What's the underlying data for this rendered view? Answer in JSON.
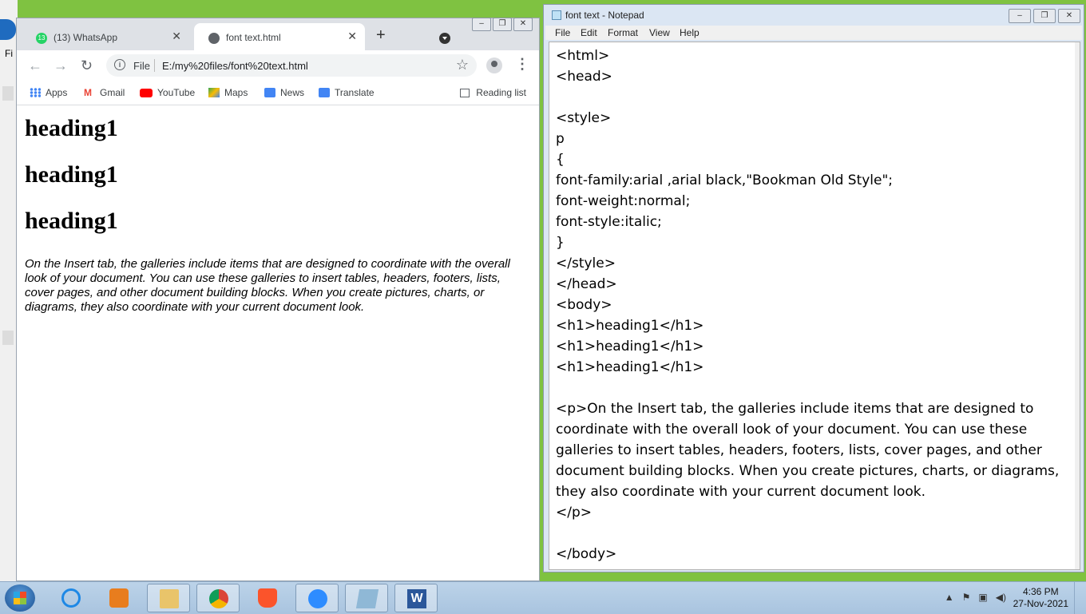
{
  "chrome": {
    "tabs": [
      {
        "title": "(13) WhatsApp",
        "badge": "13",
        "active": false
      },
      {
        "title": "font text.html",
        "active": true
      }
    ],
    "new_tab": "+",
    "address": {
      "scheme": "File",
      "url": "E:/my%20files/font%20text.html"
    },
    "bookmarks": [
      {
        "label": "Apps",
        "icon": "apps-grid-icon"
      },
      {
        "label": "Gmail",
        "icon": "gmail-icon"
      },
      {
        "label": "YouTube",
        "icon": "youtube-icon"
      },
      {
        "label": "Maps",
        "icon": "maps-icon"
      },
      {
        "label": "News",
        "icon": "news-icon"
      },
      {
        "label": "Translate",
        "icon": "translate-icon"
      }
    ],
    "reading_list": "Reading list",
    "page": {
      "headings": [
        "heading1",
        "heading1",
        "heading1"
      ],
      "paragraph": "On the Insert tab, the galleries include items that are designed to coordinate with the overall look of your document. You can use these galleries to insert tables, headers, footers, lists, cover pages, and other document building blocks. When you create pictures, charts, or diagrams, they also coordinate with your current document look."
    }
  },
  "notepad": {
    "title": "font text - Notepad",
    "menu": [
      "File",
      "Edit",
      "Format",
      "View",
      "Help"
    ],
    "lines": [
      "<html>",
      "<head>",
      "",
      "<style>",
      "p",
      "{",
      "font-family:arial ,arial black,\"Bookman Old Style\";",
      "font-weight:normal;",
      "font-style:italic;",
      "}",
      "</style>",
      "</head>",
      "<body>",
      "<h1>heading1</h1>",
      "<h1>heading1</h1>",
      "<h1>heading1</h1>",
      "",
      "<p>On the Insert tab, the galleries include items that are designed to",
      "coordinate with the overall look of your document. You can use these",
      "galleries to insert tables, headers, footers, lists, cover pages, and other",
      "document building blocks. When you create pictures, charts, or diagrams,",
      "they also coordinate with your current document look.",
      "</p>",
      "",
      "</body>"
    ]
  },
  "desktop": {
    "left_strip_text": "Fi"
  },
  "taskbar": {
    "items": [
      {
        "name": "internet-explorer",
        "icon": "ie-icon",
        "color": "#1e88e5"
      },
      {
        "name": "media-player",
        "icon": "media-player-icon",
        "color": "#e87d1e"
      },
      {
        "name": "file-explorer",
        "icon": "folder-icon",
        "color": "#e9c46a"
      },
      {
        "name": "chrome",
        "icon": "chrome-icon",
        "color": "#db4437"
      },
      {
        "name": "brave",
        "icon": "brave-icon",
        "color": "#fb542b"
      },
      {
        "name": "zoom",
        "icon": "zoom-icon",
        "color": "#2d8cff"
      },
      {
        "name": "notepad",
        "icon": "notepad-icon",
        "color": "#8fb8d6"
      },
      {
        "name": "word",
        "icon": "word-icon",
        "color": "#2b579a"
      }
    ],
    "clock": {
      "time": "4:36 PM",
      "date": "27-Nov-2021"
    }
  }
}
